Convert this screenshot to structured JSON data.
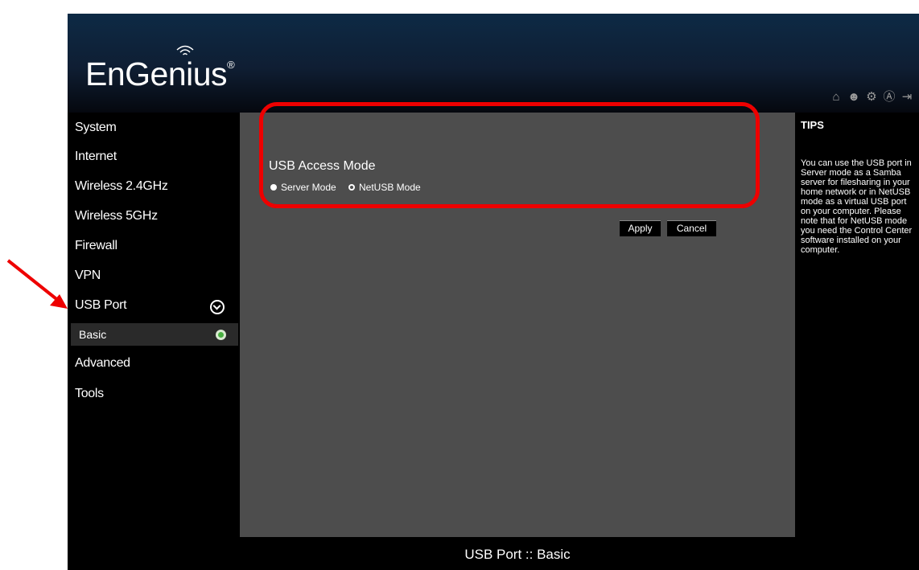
{
  "header": {
    "logo_text": "EnGenius",
    "logo_mark": "®",
    "icons": [
      "home-icon",
      "user-icon",
      "wizard-icon",
      "auto-icon",
      "logout-icon"
    ]
  },
  "sidebar": {
    "items": [
      {
        "label": "System"
      },
      {
        "label": "Internet"
      },
      {
        "label": "Wireless 2.4GHz"
      },
      {
        "label": "Wireless 5GHz"
      },
      {
        "label": "Firewall"
      },
      {
        "label": "VPN"
      },
      {
        "label": "USB Port"
      },
      {
        "label": "Advanced"
      },
      {
        "label": "Tools"
      }
    ],
    "sub_items": [
      {
        "label": "Basic"
      }
    ]
  },
  "main": {
    "section_title": "USB Access Mode",
    "options": [
      {
        "label": "Server Mode",
        "checked": false
      },
      {
        "label": "NetUSB Mode",
        "checked": true
      }
    ],
    "apply_label": "Apply",
    "cancel_label": "Cancel"
  },
  "tips": {
    "title": "TIPS",
    "text": "You can use the USB port in Server mode as a Samba server for filesharing in your home network or in NetUSB mode as a virtual USB port on your computer. Please note that for NetUSB mode you need the Control Center software installed on your computer."
  },
  "footer": {
    "title": "USB Port :: Basic"
  },
  "colors": {
    "annotation": "#ee0000",
    "content_bg": "#4d4d4d",
    "header_bg": "#0d2a45"
  }
}
